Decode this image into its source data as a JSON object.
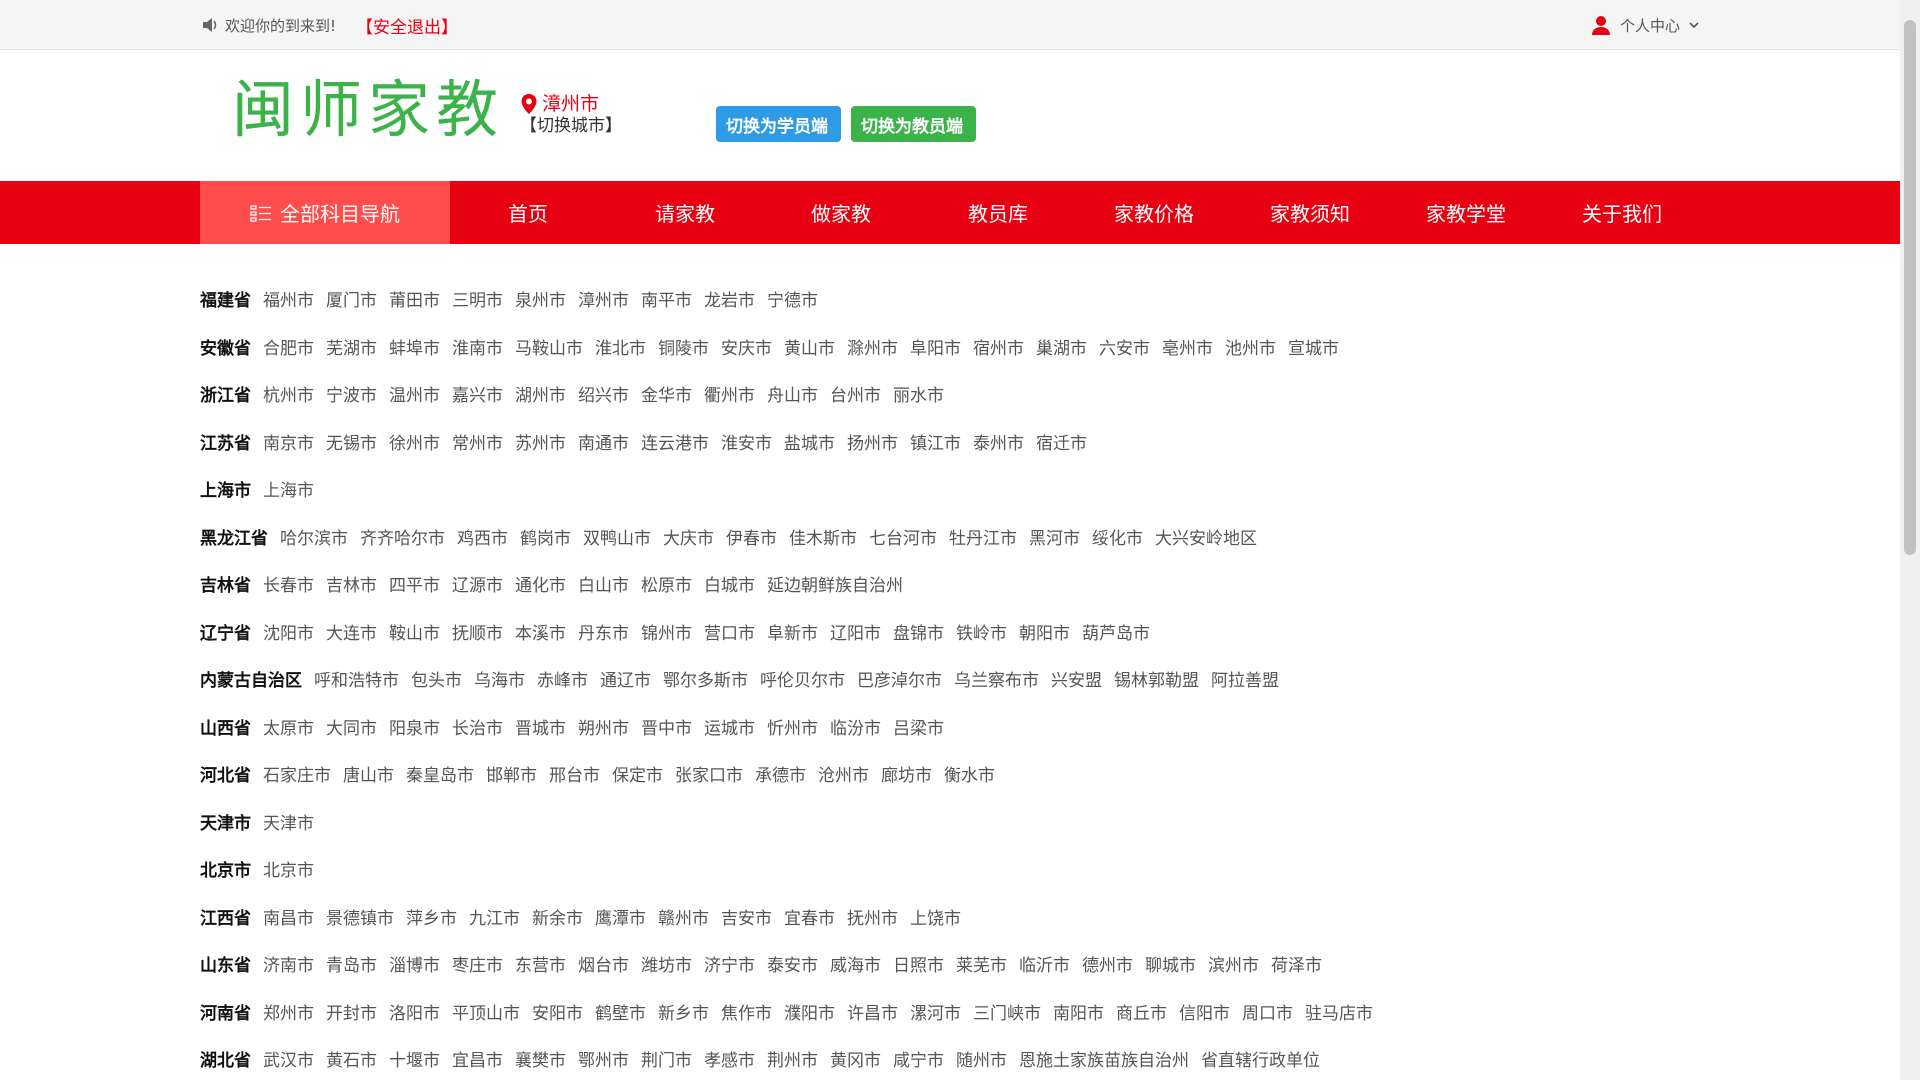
{
  "topbar": {
    "welcome": "欢迎你的到来到!",
    "logout": "【安全退出】",
    "user_center": "个人中心"
  },
  "header": {
    "logo": "闽师家教",
    "city_name": "漳州市",
    "switch_city": "【切换城市】",
    "btn_student": "切换为学员端",
    "btn_teacher": "切换为教员端"
  },
  "nav": {
    "all_subjects": "全部科目导航",
    "items": [
      "首页",
      "请家教",
      "做家教",
      "教员库",
      "家教价格",
      "家教须知",
      "家教学堂",
      "关于我们"
    ]
  },
  "provinces": [
    {
      "name": "福建省",
      "cities": [
        "福州市",
        "厦门市",
        "莆田市",
        "三明市",
        "泉州市",
        "漳州市",
        "南平市",
        "龙岩市",
        "宁德市"
      ]
    },
    {
      "name": "安徽省",
      "cities": [
        "合肥市",
        "芜湖市",
        "蚌埠市",
        "淮南市",
        "马鞍山市",
        "淮北市",
        "铜陵市",
        "安庆市",
        "黄山市",
        "滁州市",
        "阜阳市",
        "宿州市",
        "巢湖市",
        "六安市",
        "亳州市",
        "池州市",
        "宣城市"
      ]
    },
    {
      "name": "浙江省",
      "cities": [
        "杭州市",
        "宁波市",
        "温州市",
        "嘉兴市",
        "湖州市",
        "绍兴市",
        "金华市",
        "衢州市",
        "舟山市",
        "台州市",
        "丽水市"
      ]
    },
    {
      "name": "江苏省",
      "cities": [
        "南京市",
        "无锡市",
        "徐州市",
        "常州市",
        "苏州市",
        "南通市",
        "连云港市",
        "淮安市",
        "盐城市",
        "扬州市",
        "镇江市",
        "泰州市",
        "宿迁市"
      ]
    },
    {
      "name": "上海市",
      "cities": [
        "上海市"
      ]
    },
    {
      "name": "黑龙江省",
      "cities": [
        "哈尔滨市",
        "齐齐哈尔市",
        "鸡西市",
        "鹤岗市",
        "双鸭山市",
        "大庆市",
        "伊春市",
        "佳木斯市",
        "七台河市",
        "牡丹江市",
        "黑河市",
        "绥化市",
        "大兴安岭地区"
      ]
    },
    {
      "name": "吉林省",
      "cities": [
        "长春市",
        "吉林市",
        "四平市",
        "辽源市",
        "通化市",
        "白山市",
        "松原市",
        "白城市",
        "延边朝鲜族自治州"
      ]
    },
    {
      "name": "辽宁省",
      "cities": [
        "沈阳市",
        "大连市",
        "鞍山市",
        "抚顺市",
        "本溪市",
        "丹东市",
        "锦州市",
        "营口市",
        "阜新市",
        "辽阳市",
        "盘锦市",
        "铁岭市",
        "朝阳市",
        "葫芦岛市"
      ]
    },
    {
      "name": "内蒙古自治区",
      "cities": [
        "呼和浩特市",
        "包头市",
        "乌海市",
        "赤峰市",
        "通辽市",
        "鄂尔多斯市",
        "呼伦贝尔市",
        "巴彦淖尔市",
        "乌兰察布市",
        "兴安盟",
        "锡林郭勒盟",
        "阿拉善盟"
      ]
    },
    {
      "name": "山西省",
      "cities": [
        "太原市",
        "大同市",
        "阳泉市",
        "长治市",
        "晋城市",
        "朔州市",
        "晋中市",
        "运城市",
        "忻州市",
        "临汾市",
        "吕梁市"
      ]
    },
    {
      "name": "河北省",
      "cities": [
        "石家庄市",
        "唐山市",
        "秦皇岛市",
        "邯郸市",
        "邢台市",
        "保定市",
        "张家口市",
        "承德市",
        "沧州市",
        "廊坊市",
        "衡水市"
      ]
    },
    {
      "name": "天津市",
      "cities": [
        "天津市"
      ]
    },
    {
      "name": "北京市",
      "cities": [
        "北京市"
      ]
    },
    {
      "name": "江西省",
      "cities": [
        "南昌市",
        "景德镇市",
        "萍乡市",
        "九江市",
        "新余市",
        "鹰潭市",
        "赣州市",
        "吉安市",
        "宜春市",
        "抚州市",
        "上饶市"
      ]
    },
    {
      "name": "山东省",
      "cities": [
        "济南市",
        "青岛市",
        "淄博市",
        "枣庄市",
        "东营市",
        "烟台市",
        "潍坊市",
        "济宁市",
        "泰安市",
        "威海市",
        "日照市",
        "莱芜市",
        "临沂市",
        "德州市",
        "聊城市",
        "滨州市",
        "荷泽市"
      ]
    },
    {
      "name": "河南省",
      "cities": [
        "郑州市",
        "开封市",
        "洛阳市",
        "平顶山市",
        "安阳市",
        "鹤壁市",
        "新乡市",
        "焦作市",
        "濮阳市",
        "许昌市",
        "漯河市",
        "三门峡市",
        "南阳市",
        "商丘市",
        "信阳市",
        "周口市",
        "驻马店市"
      ]
    },
    {
      "name": "湖北省",
      "cities": [
        "武汉市",
        "黄石市",
        "十堰市",
        "宜昌市",
        "襄樊市",
        "鄂州市",
        "荆门市",
        "孝感市",
        "荆州市",
        "黄冈市",
        "咸宁市",
        "随州市",
        "恩施土家族苗族自治州",
        "省直辖行政单位"
      ]
    }
  ],
  "colors": {
    "brand_red": "#e60012",
    "nav_all_bg": "#ff4c4c",
    "logo_green": "#3cb34a",
    "btn_blue": "#2e9be6"
  }
}
